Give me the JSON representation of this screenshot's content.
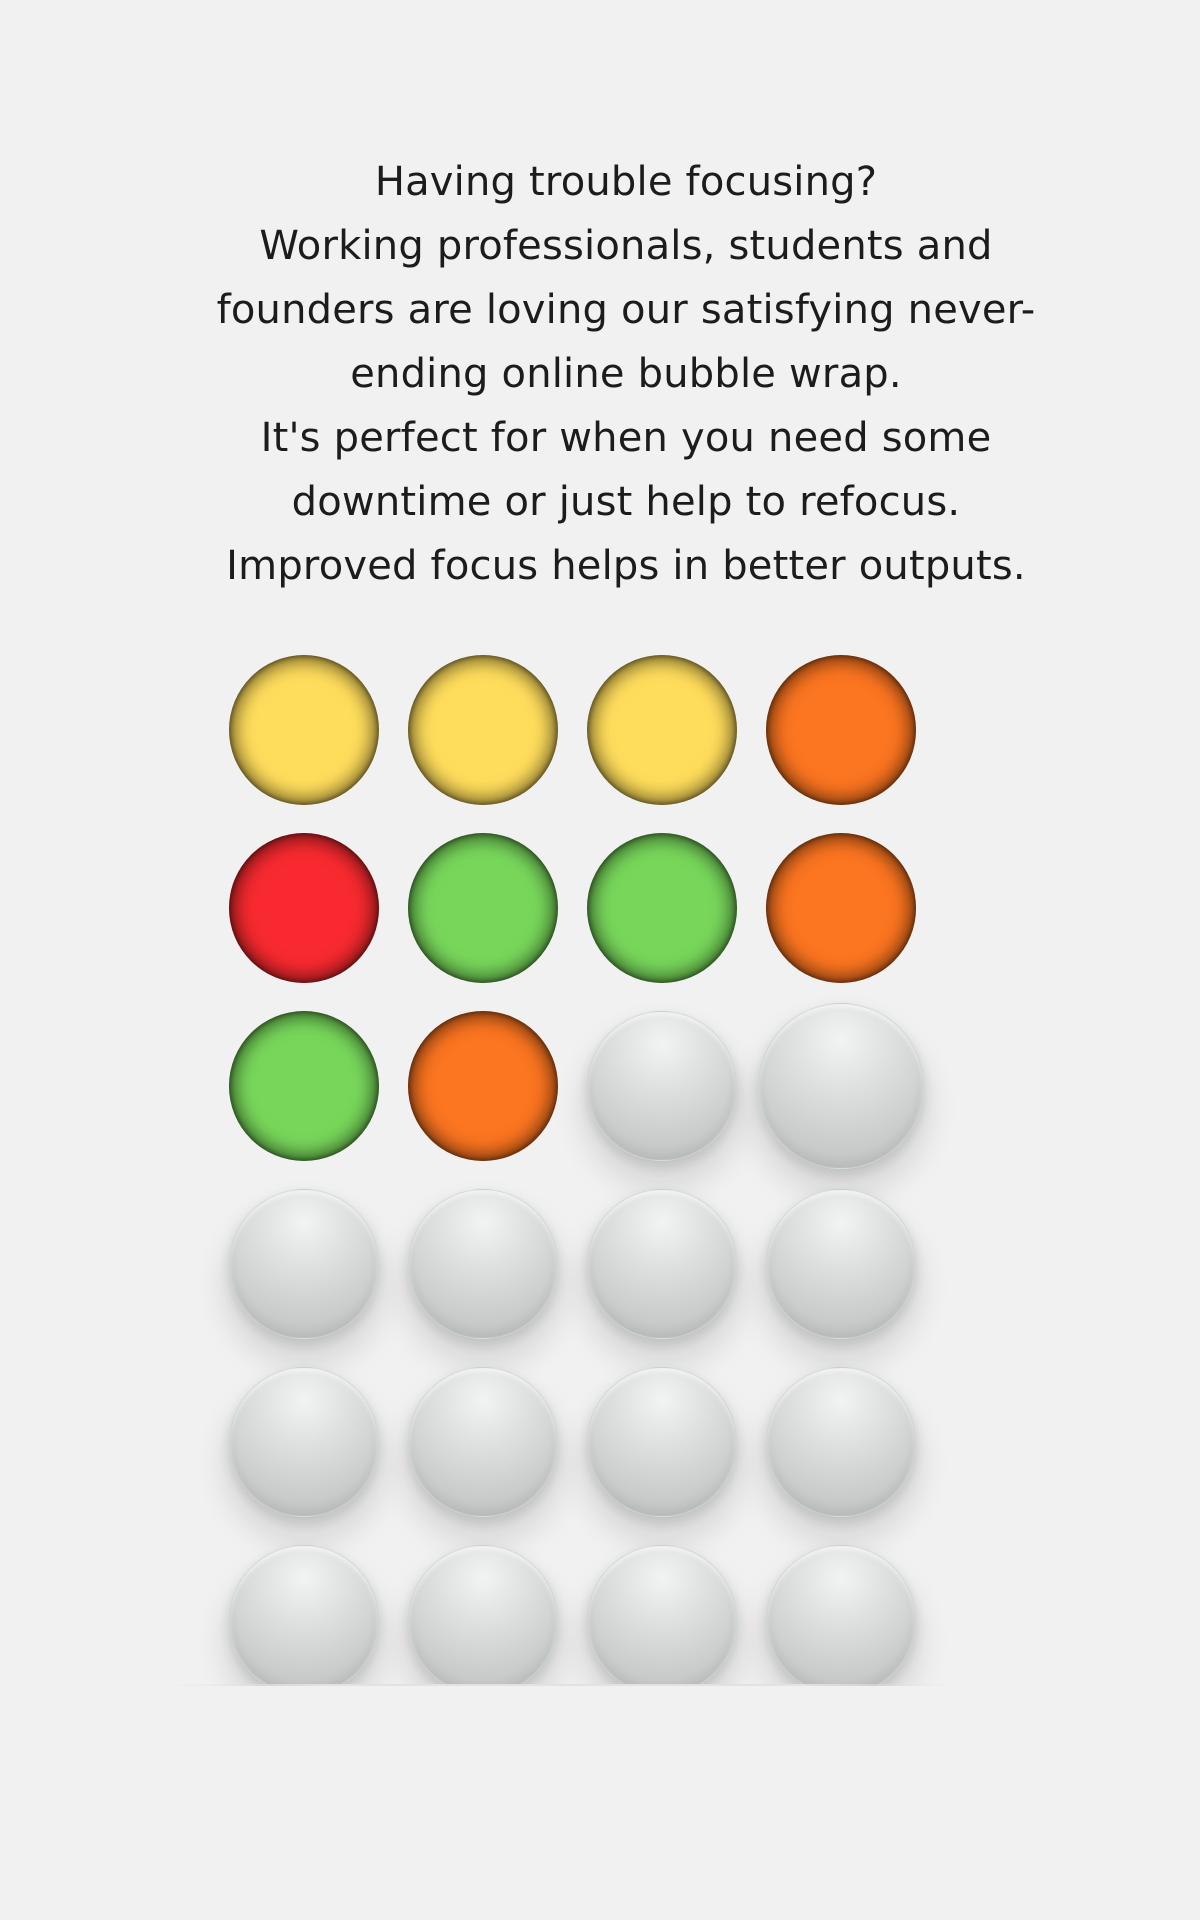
{
  "intro": {
    "lines": [
      "Having trouble focusing?",
      "Working professionals, students and founders are loving our satisfying never-ending online bubble wrap.",
      "It's perfect for when you need some downtime or just help to refocus.",
      "Improved focus helps in better outputs."
    ]
  },
  "colors": {
    "background": "#f1f1f1",
    "yellow": "#ffdd5c",
    "orange": "#fc7520",
    "red": "#f82a2f",
    "green": "#78d75b",
    "unpopped": "#cfd2d1"
  },
  "bubbles": [
    {
      "state": "popped",
      "color": "yellow"
    },
    {
      "state": "popped",
      "color": "yellow"
    },
    {
      "state": "popped",
      "color": "yellow"
    },
    {
      "state": "popped",
      "color": "orange"
    },
    {
      "state": "popped",
      "color": "red"
    },
    {
      "state": "popped",
      "color": "green"
    },
    {
      "state": "popped",
      "color": "green"
    },
    {
      "state": "popped",
      "color": "orange"
    },
    {
      "state": "popped",
      "color": "green"
    },
    {
      "state": "popped",
      "color": "orange"
    },
    {
      "state": "unpopped",
      "color": "unpopped"
    },
    {
      "state": "unpopped",
      "color": "unpopped"
    },
    {
      "state": "unpopped",
      "color": "unpopped"
    },
    {
      "state": "unpopped",
      "color": "unpopped"
    },
    {
      "state": "unpopped",
      "color": "unpopped"
    },
    {
      "state": "unpopped",
      "color": "unpopped"
    },
    {
      "state": "unpopped",
      "color": "unpopped"
    },
    {
      "state": "unpopped",
      "color": "unpopped"
    },
    {
      "state": "unpopped",
      "color": "unpopped"
    },
    {
      "state": "unpopped",
      "color": "unpopped"
    },
    {
      "state": "unpopped",
      "color": "unpopped"
    },
    {
      "state": "unpopped",
      "color": "unpopped"
    },
    {
      "state": "unpopped",
      "color": "unpopped"
    },
    {
      "state": "unpopped",
      "color": "unpopped"
    }
  ]
}
